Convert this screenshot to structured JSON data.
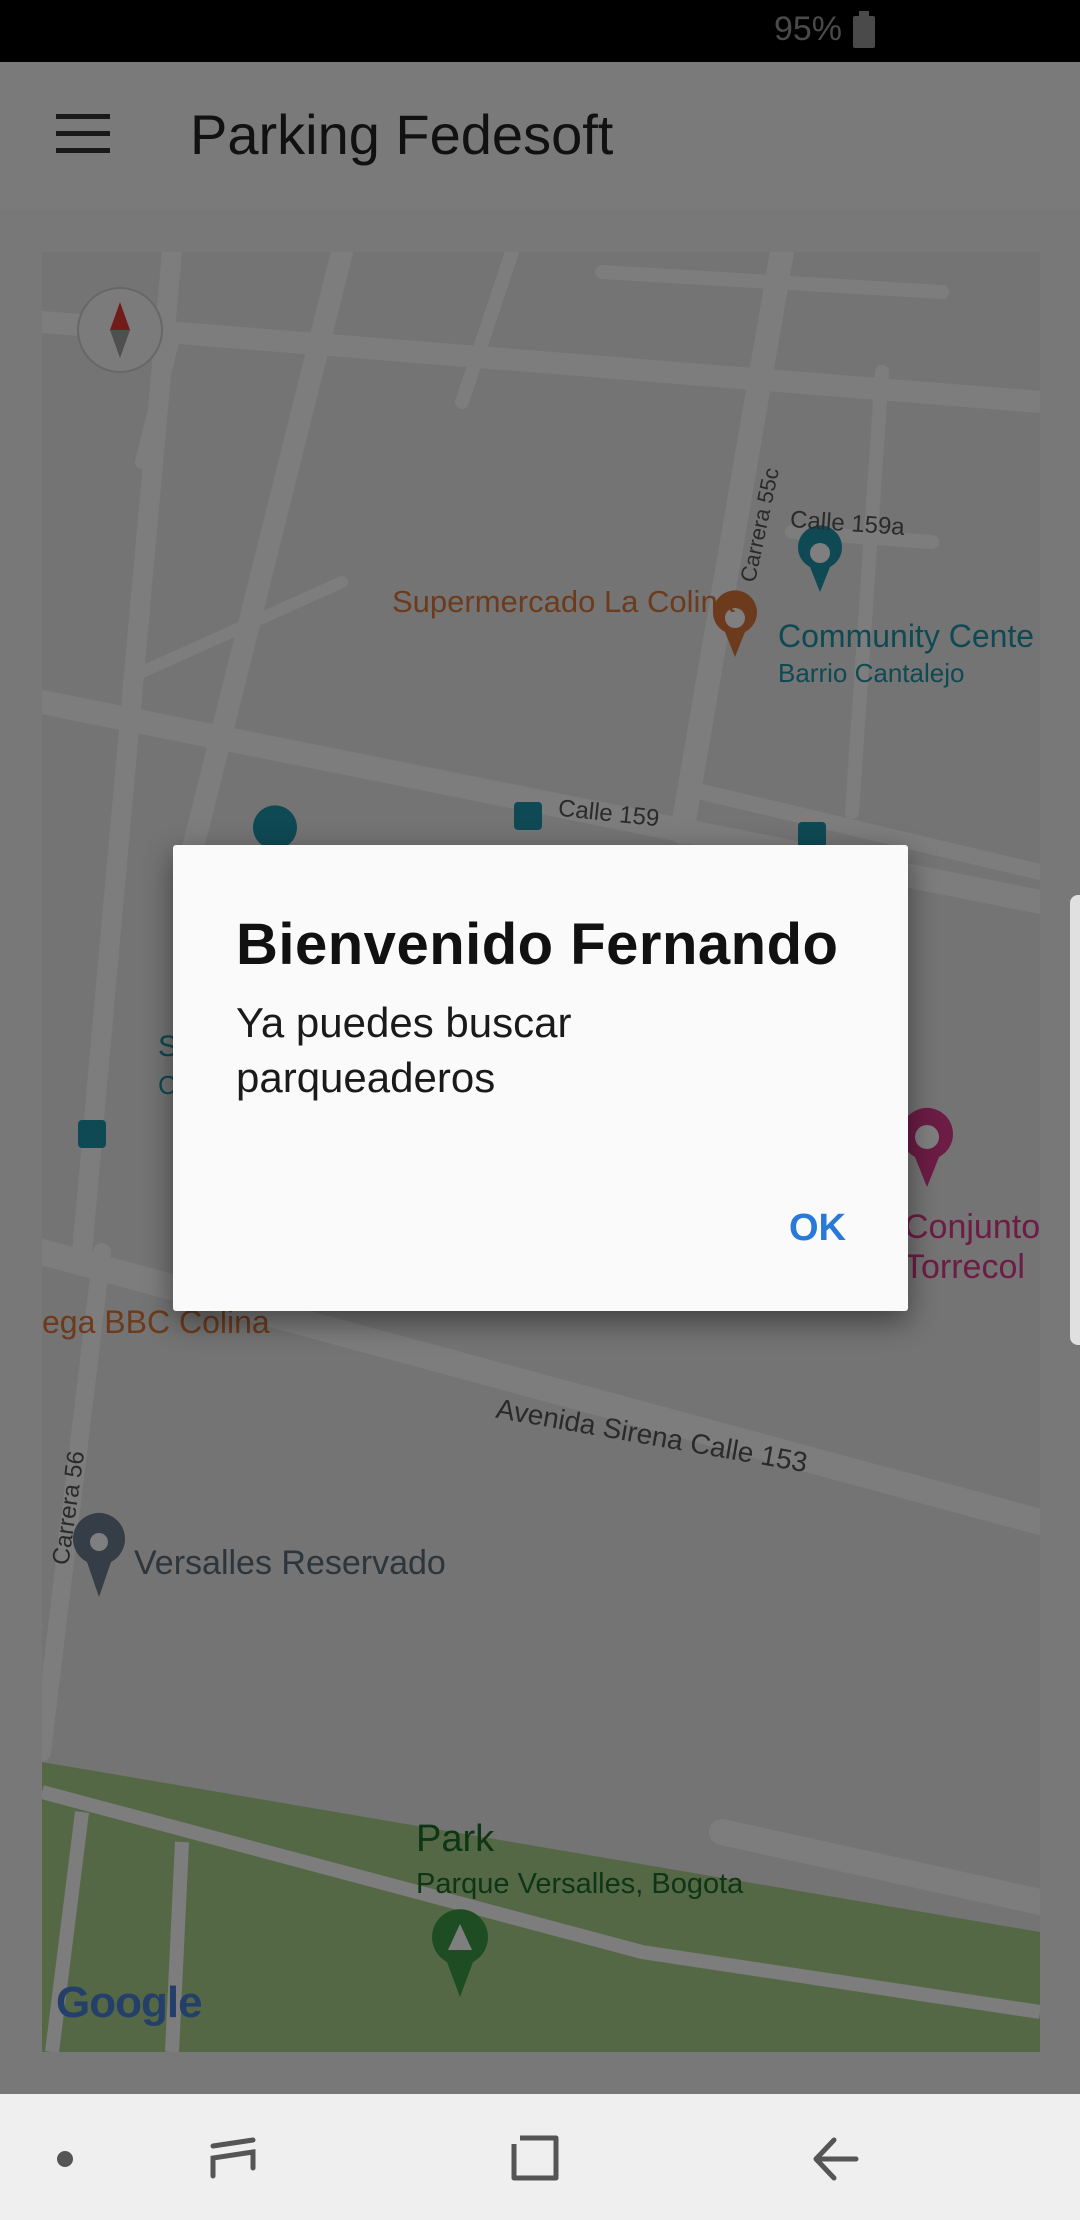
{
  "status_bar": {
    "battery": "95%"
  },
  "app_bar": {
    "title": "Parking Fedesoft",
    "menu_icon": "menu-icon"
  },
  "map": {
    "labels": {
      "supermercado": "Supermercado La Colina",
      "community_center": "Community Cente",
      "barrio": "Barrio Cantalejo",
      "calle_159a": "Calle 159a",
      "calle_159": "Calle 159",
      "carrera_55c": "Carrera 55c",
      "bodega": "ega BBC Colina",
      "avenida": "Avenida Sirena Calle 153",
      "carrera_56": "Carrera 56",
      "versalles": "Versalles Reservado",
      "park": "Park",
      "parque": "Parque Versalles, Bogota",
      "conjunto_1": "Conjunto",
      "conjunto_2": "Torrecol",
      "partial_s": "S",
      "partial_c": "C",
      "google": "Google"
    },
    "colors": {
      "poi_orange": "#d9773a",
      "poi_teal": "#1e93a8",
      "poi_pink": "#d9388a",
      "park_green": "#a8d08d",
      "park_text": "#1c6b2c"
    }
  },
  "dialog": {
    "title": "Bienvenido Fernando",
    "message": "Ya puedes buscar parqueaderos",
    "ok_label": "OK"
  },
  "nav_bar": {
    "icons": [
      "dot-icon",
      "recents-icon",
      "home-icon",
      "back-icon"
    ]
  }
}
